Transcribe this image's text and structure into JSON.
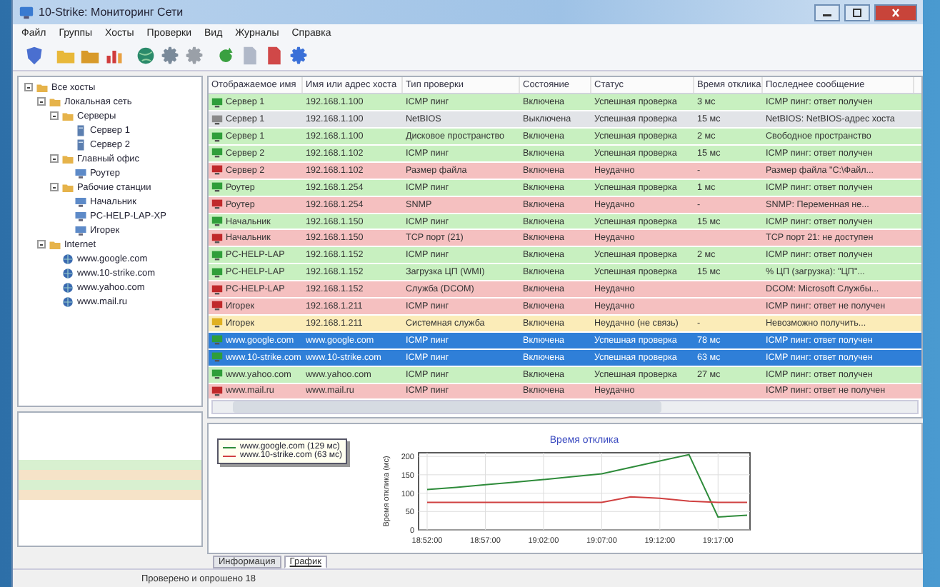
{
  "window": {
    "title": "10-Strike: Мониторинг Сети"
  },
  "menu": [
    "Файл",
    "Группы",
    "Хосты",
    "Проверки",
    "Вид",
    "Журналы",
    "Справка"
  ],
  "tree": [
    {
      "label": "Все хосты",
      "kind": "group",
      "expanded": true,
      "children": [
        {
          "label": "Локальная сеть",
          "kind": "group",
          "expanded": true,
          "children": [
            {
              "label": "Серверы",
              "kind": "group",
              "expanded": true,
              "children": [
                {
                  "label": "Сервер 1",
                  "kind": "server"
                },
                {
                  "label": "Сервер 2",
                  "kind": "server"
                }
              ]
            },
            {
              "label": "Главный офис",
              "kind": "group",
              "expanded": true,
              "children": [
                {
                  "label": "Роутер",
                  "kind": "computer"
                }
              ]
            },
            {
              "label": "Рабочие станции",
              "kind": "group",
              "expanded": true,
              "children": [
                {
                  "label": "Начальник",
                  "kind": "computer"
                },
                {
                  "label": "PC-HELP-LAP-XP",
                  "kind": "computer"
                },
                {
                  "label": "Игорек",
                  "kind": "computer"
                }
              ]
            }
          ]
        },
        {
          "label": "Internet",
          "kind": "group",
          "expanded": true,
          "children": [
            {
              "label": "www.google.com",
              "kind": "web"
            },
            {
              "label": "www.10-strike.com",
              "kind": "web"
            },
            {
              "label": "www.yahoo.com",
              "kind": "web"
            },
            {
              "label": "www.mail.ru",
              "kind": "web"
            }
          ]
        }
      ]
    }
  ],
  "table": {
    "columns": [
      "Отображаемое имя",
      "Имя или адрес хоста",
      "Тип проверки",
      "Состояние",
      "Статус",
      "Время отклика",
      "Последнее сообщение"
    ],
    "rows": [
      {
        "kind": "ok",
        "selected": false,
        "cells": [
          "Сервер 1",
          "192.168.1.100",
          "ICMP пинг",
          "Включена",
          "Успешная проверка",
          "3 мс",
          "ICMP пинг: ответ получен"
        ]
      },
      {
        "kind": "off",
        "selected": false,
        "cells": [
          "Сервер 1",
          "192.168.1.100",
          "NetBIOS",
          "Выключена",
          "Успешная проверка",
          "15 мс",
          "NetBIOS: NetBIOS-адрес хоста"
        ]
      },
      {
        "kind": "ok",
        "selected": false,
        "cells": [
          "Сервер 1",
          "192.168.1.100",
          "Дисковое пространство",
          "Включена",
          "Успешная проверка",
          "2 мс",
          "Свободное пространство"
        ]
      },
      {
        "kind": "ok",
        "selected": false,
        "cells": [
          "Сервер 2",
          "192.168.1.102",
          "ICMP пинг",
          "Включена",
          "Успешная проверка",
          "15 мс",
          "ICMP пинг: ответ получен"
        ]
      },
      {
        "kind": "fail",
        "selected": false,
        "cells": [
          "Сервер 2",
          "192.168.1.102",
          "Размер файла",
          "Включена",
          "Неудачно",
          "-",
          "Размер файла \"C:\\Файл..."
        ]
      },
      {
        "kind": "ok",
        "selected": false,
        "cells": [
          "Роутер",
          "192.168.1.254",
          "ICMP пинг",
          "Включена",
          "Успешная проверка",
          "1 мс",
          "ICMP пинг: ответ получен"
        ]
      },
      {
        "kind": "fail",
        "selected": false,
        "cells": [
          "Роутер",
          "192.168.1.254",
          "SNMP",
          "Включена",
          "Неудачно",
          "-",
          "SNMP: Переменная не..."
        ]
      },
      {
        "kind": "ok",
        "selected": false,
        "cells": [
          "Начальник",
          "192.168.1.150",
          "ICMP пинг",
          "Включена",
          "Успешная проверка",
          "15 мс",
          "ICMP пинг: ответ получен"
        ]
      },
      {
        "kind": "fail",
        "selected": false,
        "cells": [
          "Начальник",
          "192.168.1.150",
          "TCP порт (21)",
          "Включена",
          "Неудачно",
          "",
          "TCP порт 21: не доступен"
        ]
      },
      {
        "kind": "ok",
        "selected": false,
        "cells": [
          "PC-HELP-LAP",
          "192.168.1.152",
          "ICMP пинг",
          "Включена",
          "Успешная проверка",
          "2 мс",
          "ICMP пинг: ответ получен"
        ]
      },
      {
        "kind": "ok",
        "selected": false,
        "cells": [
          "PC-HELP-LAP",
          "192.168.1.152",
          "Загрузка ЦП (WMI)",
          "Включена",
          "Успешная проверка",
          "15 мс",
          "% ЦП (загрузка): \"ЦП\"..."
        ]
      },
      {
        "kind": "fail",
        "selected": false,
        "cells": [
          "PC-HELP-LAP",
          "192.168.1.152",
          "Служба (DCOM)",
          "Включена",
          "Неудачно",
          "",
          "DCOM: Microsoft Службы..."
        ]
      },
      {
        "kind": "fail",
        "selected": false,
        "cells": [
          "Игорек",
          "192.168.1.211",
          "ICMP пинг",
          "Включена",
          "Неудачно",
          "",
          "ICMP пинг: ответ не получен"
        ]
      },
      {
        "kind": "warn",
        "selected": false,
        "cells": [
          "Игорек",
          "192.168.1.211",
          "Системная служба",
          "Включена",
          "Неудачно (не связь)",
          "-",
          "Невозможно получить..."
        ]
      },
      {
        "kind": "ok",
        "selected": true,
        "cells": [
          "www.google.com",
          "www.google.com",
          "ICMP пинг",
          "Включена",
          "Успешная проверка",
          "78 мс",
          "ICMP пинг: ответ получен"
        ]
      },
      {
        "kind": "ok",
        "selected": true,
        "cells": [
          "www.10-strike.com",
          "www.10-strike.com",
          "ICMP пинг",
          "Включена",
          "Успешная проверка",
          "63 мс",
          "ICMP пинг: ответ получен"
        ]
      },
      {
        "kind": "ok",
        "selected": false,
        "cells": [
          "www.yahoo.com",
          "www.yahoo.com",
          "ICMP пинг",
          "Включена",
          "Успешная проверка",
          "27 мс",
          "ICMP пинг: ответ получен"
        ]
      },
      {
        "kind": "fail",
        "selected": false,
        "cells": [
          "www.mail.ru",
          "www.mail.ru",
          "ICMP пинг",
          "Включена",
          "Неудачно",
          "",
          "ICMP пинг: ответ не получен"
        ]
      }
    ]
  },
  "chart_data": {
    "type": "line",
    "title": "Время отклика",
    "ylabel": "Время отклика (мс)",
    "categories": [
      "18:52:00",
      null,
      "18:57:00",
      null,
      "19:02:00",
      null,
      "19:07:00",
      null,
      "19:12:00",
      null,
      "19:17:00",
      null
    ],
    "ylim": [
      0,
      210
    ],
    "yticks": [
      0,
      50,
      100,
      150,
      200
    ],
    "grid": true,
    "series": [
      {
        "name": "www.google.com (129 мс)",
        "color": "#2e8b3a",
        "values": [
          110,
          116,
          123,
          130,
          137,
          145,
          153,
          170,
          188,
          205,
          35,
          40
        ]
      },
      {
        "name": "www.10-strike.com (63 мс)",
        "color": "#d04040",
        "values": [
          75,
          75,
          75,
          75,
          75,
          75,
          75,
          90,
          86,
          78,
          75,
          75
        ]
      }
    ]
  },
  "bottom_tabs": [
    {
      "label": "Информация",
      "selected": false
    },
    {
      "label": "График",
      "selected": true
    }
  ],
  "status_bar": "Проверено и опрошено 18"
}
